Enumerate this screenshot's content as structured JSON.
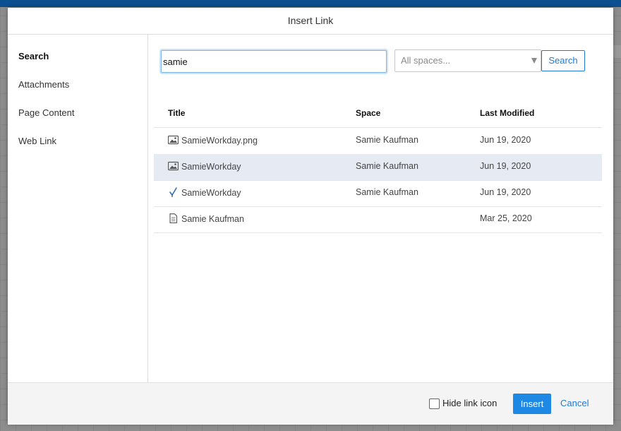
{
  "dialog": {
    "title": "Insert Link"
  },
  "sidebar": {
    "items": [
      {
        "label": "Search",
        "active": true
      },
      {
        "label": "Attachments",
        "active": false
      },
      {
        "label": "Page Content",
        "active": false
      },
      {
        "label": "Web Link",
        "active": false
      }
    ]
  },
  "search": {
    "query": "samie",
    "space_placeholder": "All spaces...",
    "button_label": "Search"
  },
  "results": {
    "columns": [
      "Title",
      "Space",
      "Last Modified"
    ],
    "rows": [
      {
        "icon": "image-icon",
        "title": "SamieWorkday.png",
        "space": "Samie Kaufman",
        "modified": "Jun 19, 2020",
        "selected": false
      },
      {
        "icon": "image-icon",
        "title": "SamieWorkday",
        "space": "Samie Kaufman",
        "modified": "Jun 19, 2020",
        "selected": true
      },
      {
        "icon": "whiteboard-icon",
        "title": "SamieWorkday",
        "space": "Samie Kaufman",
        "modified": "Jun 19, 2020",
        "selected": false
      },
      {
        "icon": "page-icon",
        "title": "Samie Kaufman",
        "space": "",
        "modified": "Mar 25, 2020",
        "selected": false
      }
    ]
  },
  "footer": {
    "hide_link_icon_label": "Hide link icon",
    "hide_link_icon_checked": false,
    "insert_label": "Insert",
    "cancel_label": "Cancel"
  },
  "colors": {
    "accent": "#1e88e5",
    "selected_row": "#e6ebf3",
    "header_bar": "#0b4f8e"
  }
}
